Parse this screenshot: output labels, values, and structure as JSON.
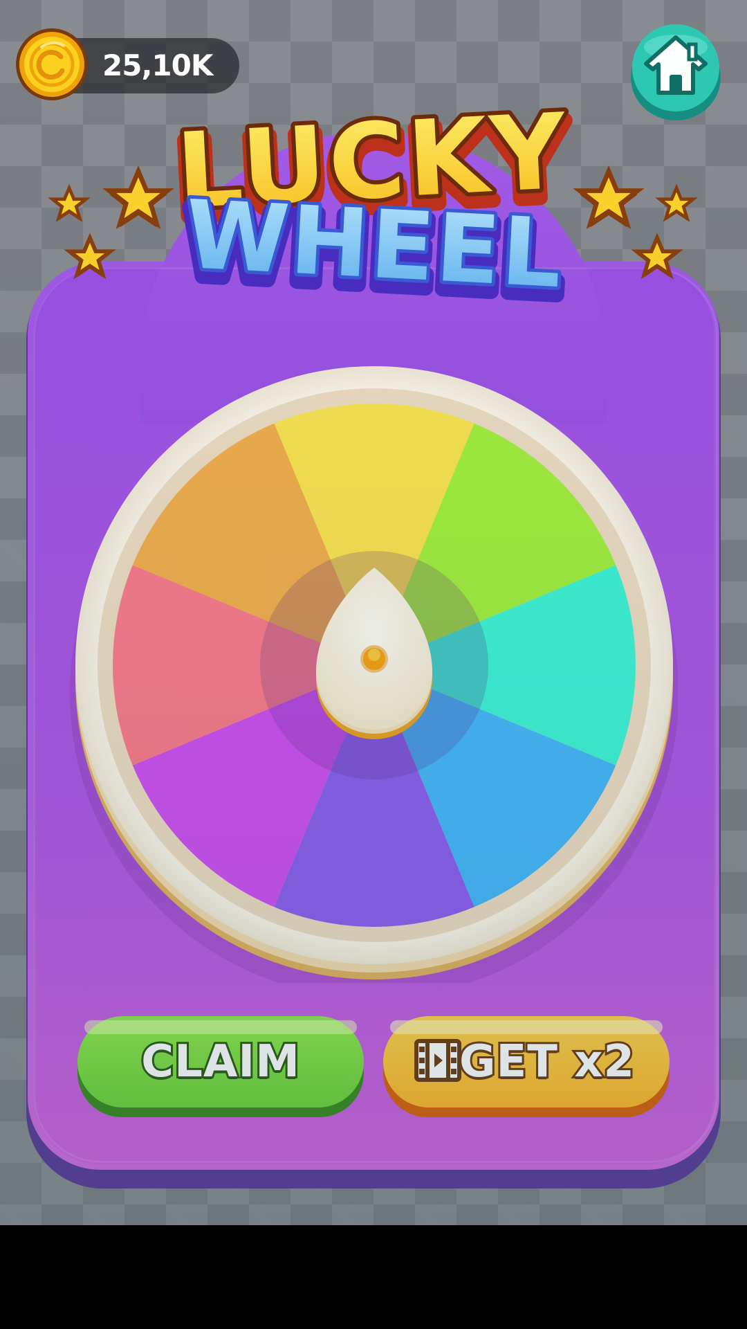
{
  "hud": {
    "coin_balance": "25,10K",
    "coin_icon": "gold-coin-icon",
    "home_icon": "home-icon"
  },
  "title": {
    "line1": "LUCKY",
    "line2": "WHEEL"
  },
  "wheel": {
    "segment_colors": [
      "#fce44e",
      "#a3f03c",
      "#3df5d6",
      "#45b8fb",
      "#8c5ef0",
      "#d04ef2",
      "#fd7a8c",
      "#f4ae4a"
    ],
    "pointer_icon": "wheel-pointer-icon"
  },
  "buttons": {
    "claim_label": "CLAIM",
    "get_x2_label": "GET x2",
    "get_x2_icon": "video-ad-icon"
  },
  "colors": {
    "panel": "#9b4fe6",
    "claim": "#6cd43a",
    "get_x2": "#ffb82a",
    "home": "#2ec9b3"
  }
}
